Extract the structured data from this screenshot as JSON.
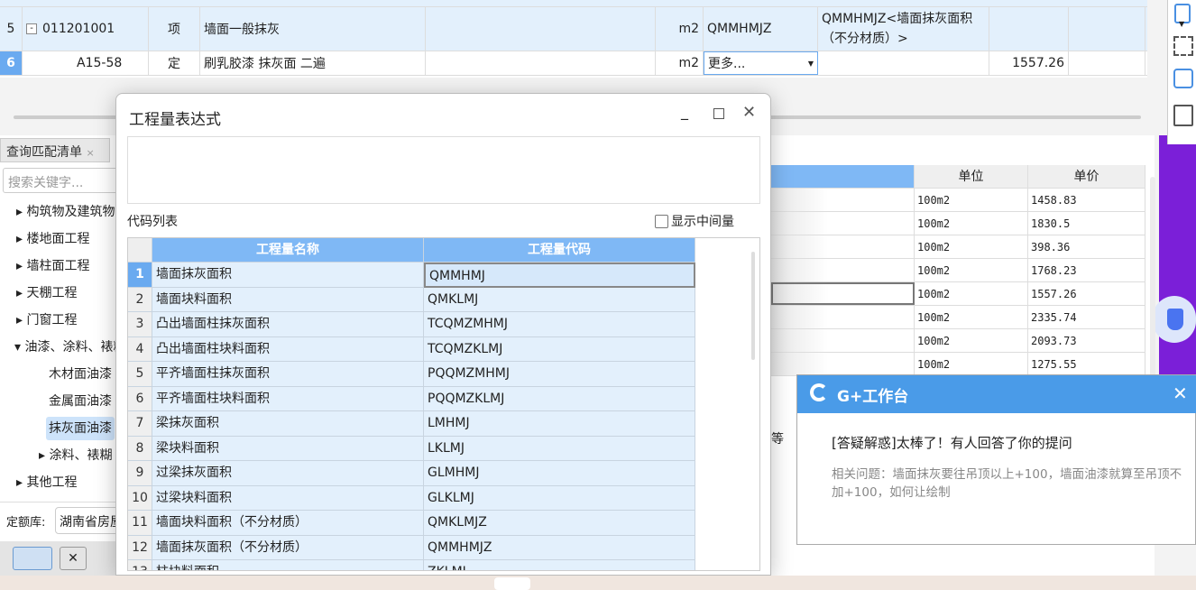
{
  "top_grid": {
    "rows": [
      {
        "num": "5",
        "code": "011201001",
        "type": "项",
        "name": "墙面一般抹灰",
        "unit": "m2",
        "qty_code": "QMMHMJZ",
        "expr": "QMMHMJZ<墙面抹灰面积（不分材质）>",
        "price": ""
      },
      {
        "num": "6",
        "code": "A15-58",
        "type": "定",
        "name": "刷乳胶漆 抹灰面 二遍",
        "unit": "m2",
        "qty_code": "更多...",
        "expr": "",
        "price": "1557.26"
      }
    ]
  },
  "lower_panel": {
    "tab_label": "查询匹配清单",
    "tab_close": "×",
    "search_placeholder": "搜索关键字...",
    "tree": [
      {
        "label": "构筑物及建筑物",
        "level": 0,
        "expanded": false
      },
      {
        "label": "楼地面工程",
        "level": 0
      },
      {
        "label": "墙柱面工程",
        "level": 0
      },
      {
        "label": "天棚工程",
        "level": 0
      },
      {
        "label": "门窗工程",
        "level": 0
      },
      {
        "label": "油漆、涂料、裱糊",
        "level": 0,
        "expanded": true
      },
      {
        "label": "木材面油漆",
        "level": 1
      },
      {
        "label": "金属面油漆",
        "level": 1
      },
      {
        "label": "抹灰面油漆",
        "level": 1,
        "selected": true
      },
      {
        "label": "涂料、裱糊",
        "level": 1
      },
      {
        "label": "其他工程",
        "level": 0
      }
    ],
    "quota_label": "定额库:",
    "quota_value": "湖南省房屋建筑"
  },
  "right_table": {
    "headers": [
      "单位",
      "单价"
    ],
    "partial_text": "等",
    "rows": [
      [
        "100m2",
        "1458.83"
      ],
      [
        "100m2",
        "1830.5"
      ],
      [
        "100m2",
        "398.36"
      ],
      [
        "100m2",
        "1768.23"
      ],
      [
        "100m2",
        "1557.26"
      ],
      [
        "100m2",
        "2335.74"
      ],
      [
        "100m2",
        "2093.73"
      ],
      [
        "100m2",
        "1275.55"
      ]
    ]
  },
  "dialog": {
    "title": "工程量表达式",
    "expression": "",
    "code_list_label": "代码列表",
    "show_intermediate": "显示中间量",
    "headers": [
      "工程量名称",
      "工程量代码"
    ],
    "rows": [
      [
        "1",
        "墙面抹灰面积",
        "QMMHMJ"
      ],
      [
        "2",
        "墙面块料面积",
        "QMKLMJ"
      ],
      [
        "3",
        "凸出墙面柱抹灰面积",
        "TCQMZMHMJ"
      ],
      [
        "4",
        "凸出墙面柱块料面积",
        "TCQMZKLMJ"
      ],
      [
        "5",
        "平齐墙面柱抹灰面积",
        "PQQMZMHMJ"
      ],
      [
        "6",
        "平齐墙面柱块料面积",
        "PQQMZKLMJ"
      ],
      [
        "7",
        "梁抹灰面积",
        "LMHMJ"
      ],
      [
        "8",
        "梁块料面积",
        "LKLMJ"
      ],
      [
        "9",
        "过梁抹灰面积",
        "GLMHMJ"
      ],
      [
        "10",
        "过梁块料面积",
        "GLKLMJ"
      ],
      [
        "11",
        "墙面块料面积（不分材质）",
        "QMKLMJZ"
      ],
      [
        "12",
        "墙面抹灰面积（不分材质）",
        "QMMHMJZ"
      ],
      [
        "13",
        "柱块料面积",
        "ZKLMJ"
      ]
    ]
  },
  "notification": {
    "app": "G+工作台",
    "title": "[答疑解惑]太棒了！有人回答了你的提问",
    "body": "相关问题：墙面抹灰要往吊顶以上+100，墙面油漆就算至吊顶不加+100，如何让绘制"
  },
  "colors": {
    "header_blue": "#7fb8f5",
    "row_blue": "#e3f0fc",
    "notify_blue": "#4a9be8",
    "purple": "#7b1fd8"
  }
}
